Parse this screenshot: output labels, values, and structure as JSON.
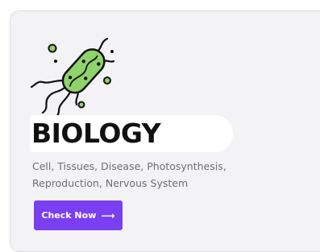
{
  "card": {
    "icon": "bacteria-icon",
    "title": "BIOLOGY",
    "description": "Cell, Tissues, Disease, Photosynthesis, Reproduction, Nervous System",
    "button_label": "Check Now",
    "button_icon": "arrow-right-icon"
  },
  "colors": {
    "accent": "#7a3ff0",
    "bacteria_fill": "#8fd46a",
    "card_bg": "#f3f3f5"
  }
}
